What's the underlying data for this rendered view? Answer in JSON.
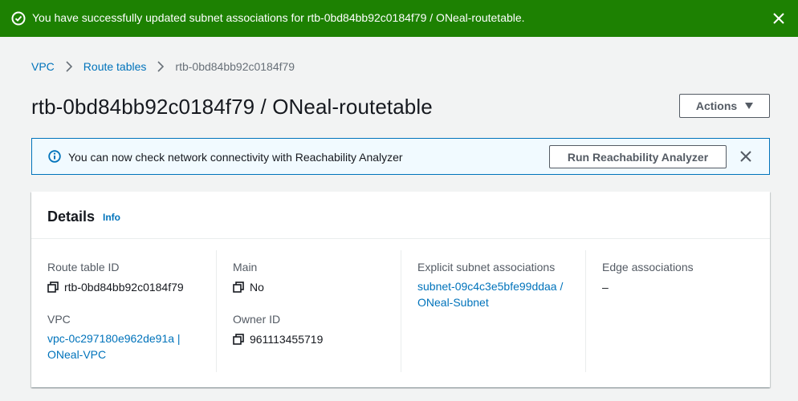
{
  "flash": {
    "message": "You have successfully updated subnet associations for rtb-0bd84bb92c0184f79 / ONeal-routetable.",
    "icon": "check-circle-icon",
    "color": "#1d8102"
  },
  "breadcrumb": {
    "items": [
      "VPC",
      "Route tables",
      "rtb-0bd84bb92c0184f79"
    ]
  },
  "page": {
    "title": "rtb-0bd84bb92c0184f79 / ONeal-routetable",
    "actions_label": "Actions"
  },
  "info_alert": {
    "text": "You can now check network connectivity with Reachability Analyzer",
    "button_label": "Run Reachability Analyzer"
  },
  "details": {
    "title": "Details",
    "info_label": "Info",
    "route_table_id_label": "Route table ID",
    "route_table_id": "rtb-0bd84bb92c0184f79",
    "vpc_label": "VPC",
    "vpc_line1": "vpc-0c297180e962de91a |",
    "vpc_line2": "ONeal-VPC",
    "main_label": "Main",
    "main_value": "No",
    "owner_id_label": "Owner ID",
    "owner_id": "961113455719",
    "explicit_label": "Explicit subnet associations",
    "explicit_line1": "subnet-09c4c3e5bfe99ddaa /",
    "explicit_line2": "ONeal-Subnet",
    "edge_label": "Edge associations",
    "edge_value": "–"
  },
  "colors": {
    "link": "#0073bb",
    "success": "#1d8102",
    "info_border": "#0073bb"
  }
}
